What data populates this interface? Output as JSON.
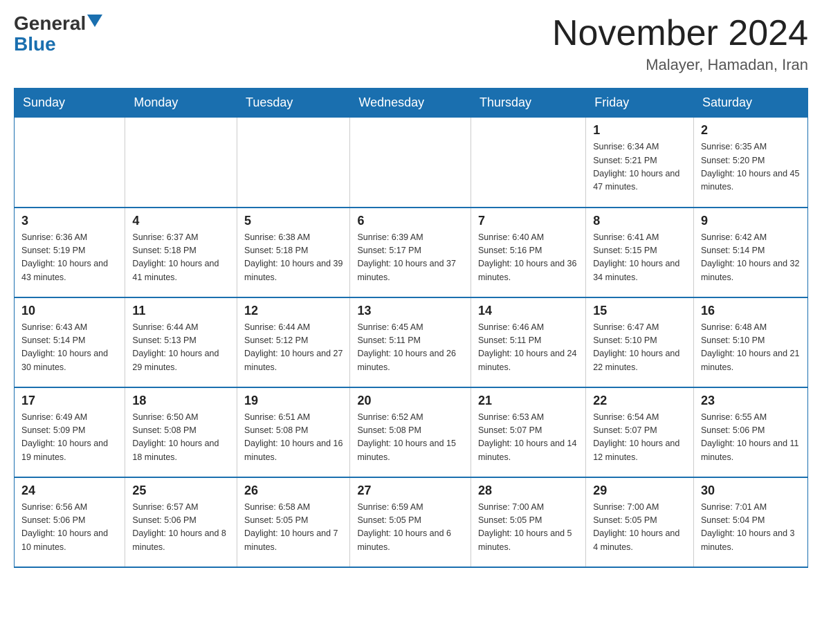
{
  "header": {
    "logo_general": "General",
    "logo_blue": "Blue",
    "month_title": "November 2024",
    "location": "Malayer, Hamadan, Iran"
  },
  "days_of_week": [
    "Sunday",
    "Monday",
    "Tuesday",
    "Wednesday",
    "Thursday",
    "Friday",
    "Saturday"
  ],
  "weeks": [
    [
      {
        "day": "",
        "info": ""
      },
      {
        "day": "",
        "info": ""
      },
      {
        "day": "",
        "info": ""
      },
      {
        "day": "",
        "info": ""
      },
      {
        "day": "",
        "info": ""
      },
      {
        "day": "1",
        "info": "Sunrise: 6:34 AM\nSunset: 5:21 PM\nDaylight: 10 hours and 47 minutes."
      },
      {
        "day": "2",
        "info": "Sunrise: 6:35 AM\nSunset: 5:20 PM\nDaylight: 10 hours and 45 minutes."
      }
    ],
    [
      {
        "day": "3",
        "info": "Sunrise: 6:36 AM\nSunset: 5:19 PM\nDaylight: 10 hours and 43 minutes."
      },
      {
        "day": "4",
        "info": "Sunrise: 6:37 AM\nSunset: 5:18 PM\nDaylight: 10 hours and 41 minutes."
      },
      {
        "day": "5",
        "info": "Sunrise: 6:38 AM\nSunset: 5:18 PM\nDaylight: 10 hours and 39 minutes."
      },
      {
        "day": "6",
        "info": "Sunrise: 6:39 AM\nSunset: 5:17 PM\nDaylight: 10 hours and 37 minutes."
      },
      {
        "day": "7",
        "info": "Sunrise: 6:40 AM\nSunset: 5:16 PM\nDaylight: 10 hours and 36 minutes."
      },
      {
        "day": "8",
        "info": "Sunrise: 6:41 AM\nSunset: 5:15 PM\nDaylight: 10 hours and 34 minutes."
      },
      {
        "day": "9",
        "info": "Sunrise: 6:42 AM\nSunset: 5:14 PM\nDaylight: 10 hours and 32 minutes."
      }
    ],
    [
      {
        "day": "10",
        "info": "Sunrise: 6:43 AM\nSunset: 5:14 PM\nDaylight: 10 hours and 30 minutes."
      },
      {
        "day": "11",
        "info": "Sunrise: 6:44 AM\nSunset: 5:13 PM\nDaylight: 10 hours and 29 minutes."
      },
      {
        "day": "12",
        "info": "Sunrise: 6:44 AM\nSunset: 5:12 PM\nDaylight: 10 hours and 27 minutes."
      },
      {
        "day": "13",
        "info": "Sunrise: 6:45 AM\nSunset: 5:11 PM\nDaylight: 10 hours and 26 minutes."
      },
      {
        "day": "14",
        "info": "Sunrise: 6:46 AM\nSunset: 5:11 PM\nDaylight: 10 hours and 24 minutes."
      },
      {
        "day": "15",
        "info": "Sunrise: 6:47 AM\nSunset: 5:10 PM\nDaylight: 10 hours and 22 minutes."
      },
      {
        "day": "16",
        "info": "Sunrise: 6:48 AM\nSunset: 5:10 PM\nDaylight: 10 hours and 21 minutes."
      }
    ],
    [
      {
        "day": "17",
        "info": "Sunrise: 6:49 AM\nSunset: 5:09 PM\nDaylight: 10 hours and 19 minutes."
      },
      {
        "day": "18",
        "info": "Sunrise: 6:50 AM\nSunset: 5:08 PM\nDaylight: 10 hours and 18 minutes."
      },
      {
        "day": "19",
        "info": "Sunrise: 6:51 AM\nSunset: 5:08 PM\nDaylight: 10 hours and 16 minutes."
      },
      {
        "day": "20",
        "info": "Sunrise: 6:52 AM\nSunset: 5:08 PM\nDaylight: 10 hours and 15 minutes."
      },
      {
        "day": "21",
        "info": "Sunrise: 6:53 AM\nSunset: 5:07 PM\nDaylight: 10 hours and 14 minutes."
      },
      {
        "day": "22",
        "info": "Sunrise: 6:54 AM\nSunset: 5:07 PM\nDaylight: 10 hours and 12 minutes."
      },
      {
        "day": "23",
        "info": "Sunrise: 6:55 AM\nSunset: 5:06 PM\nDaylight: 10 hours and 11 minutes."
      }
    ],
    [
      {
        "day": "24",
        "info": "Sunrise: 6:56 AM\nSunset: 5:06 PM\nDaylight: 10 hours and 10 minutes."
      },
      {
        "day": "25",
        "info": "Sunrise: 6:57 AM\nSunset: 5:06 PM\nDaylight: 10 hours and 8 minutes."
      },
      {
        "day": "26",
        "info": "Sunrise: 6:58 AM\nSunset: 5:05 PM\nDaylight: 10 hours and 7 minutes."
      },
      {
        "day": "27",
        "info": "Sunrise: 6:59 AM\nSunset: 5:05 PM\nDaylight: 10 hours and 6 minutes."
      },
      {
        "day": "28",
        "info": "Sunrise: 7:00 AM\nSunset: 5:05 PM\nDaylight: 10 hours and 5 minutes."
      },
      {
        "day": "29",
        "info": "Sunrise: 7:00 AM\nSunset: 5:05 PM\nDaylight: 10 hours and 4 minutes."
      },
      {
        "day": "30",
        "info": "Sunrise: 7:01 AM\nSunset: 5:04 PM\nDaylight: 10 hours and 3 minutes."
      }
    ]
  ]
}
